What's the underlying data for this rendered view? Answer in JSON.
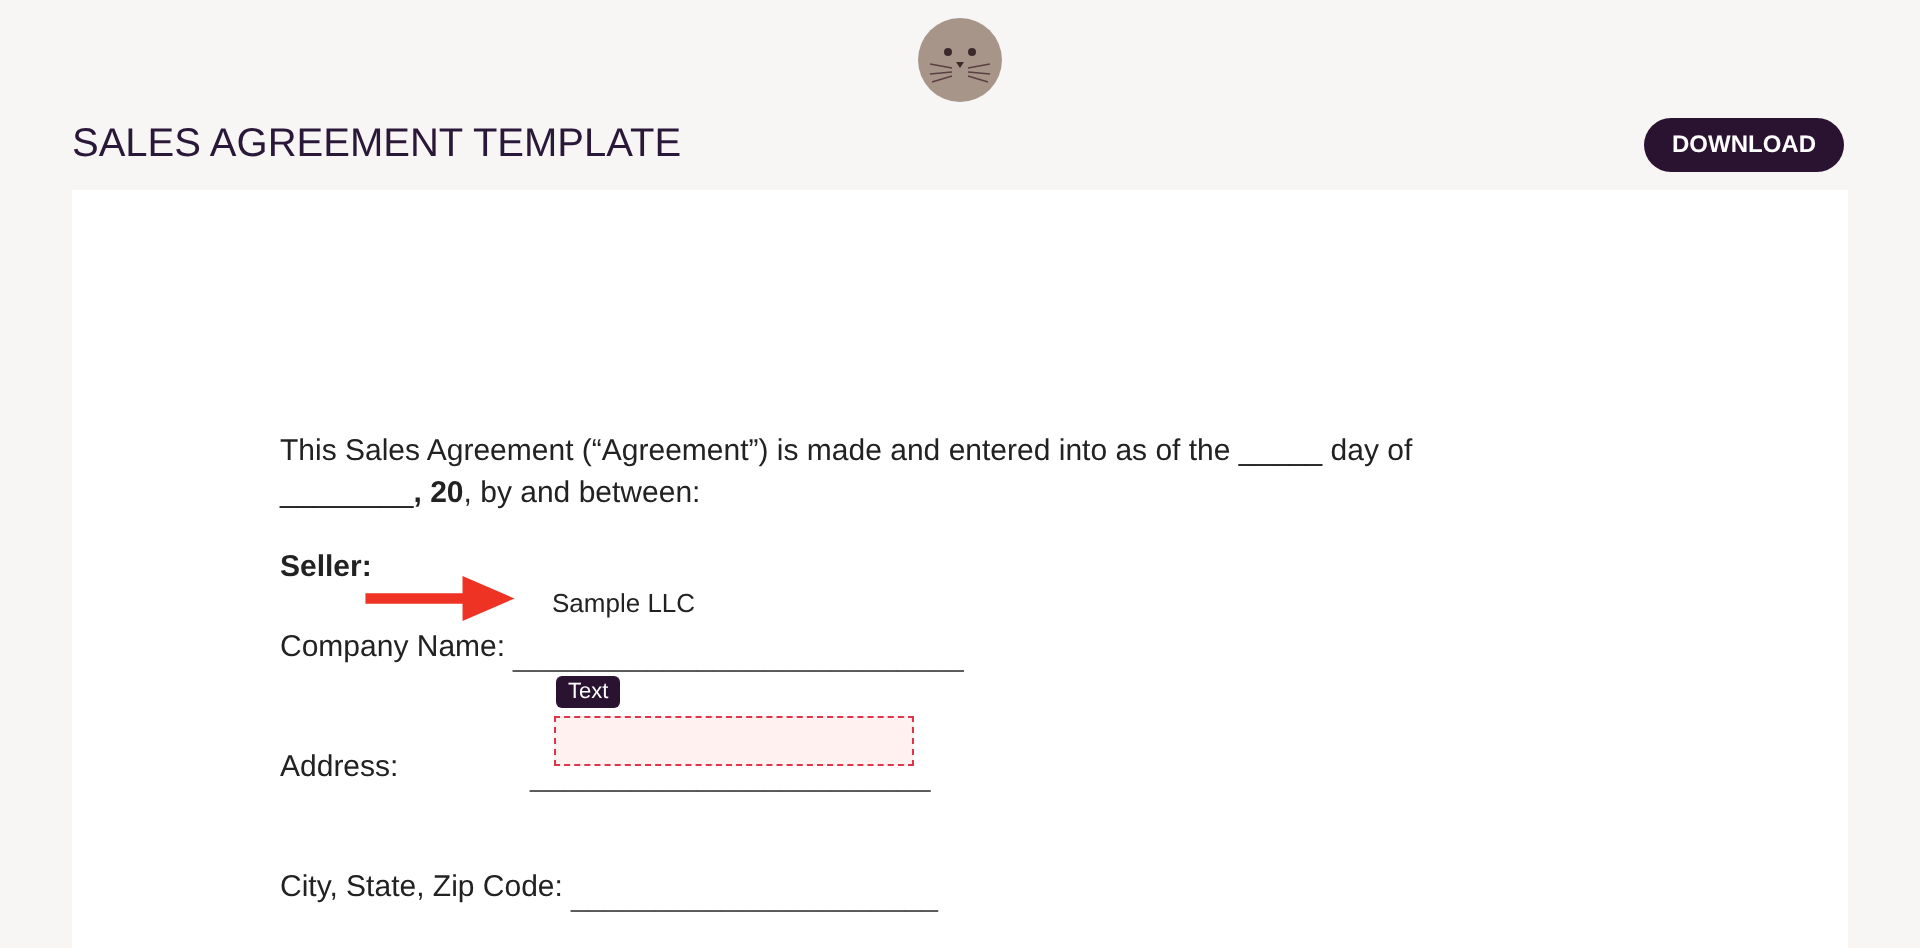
{
  "header": {
    "title": "SALES AGREEMENT TEMPLATE",
    "button": "DOWNLOAD"
  },
  "document": {
    "intro": "This Sales Agreement (“Agreement”) is made and entered into as of the _____ day of ________**, 20**, by and between:",
    "section": "Seller:",
    "fields": [
      {
        "label": "Company Name:",
        "blank": "___________________________",
        "value": "Sample LLC"
      },
      {
        "label": "Address:",
        "blank": "________________________",
        "tag": "Text"
      },
      {
        "label": "City, State, Zip Code:",
        "blank": "______________________"
      }
    ]
  }
}
